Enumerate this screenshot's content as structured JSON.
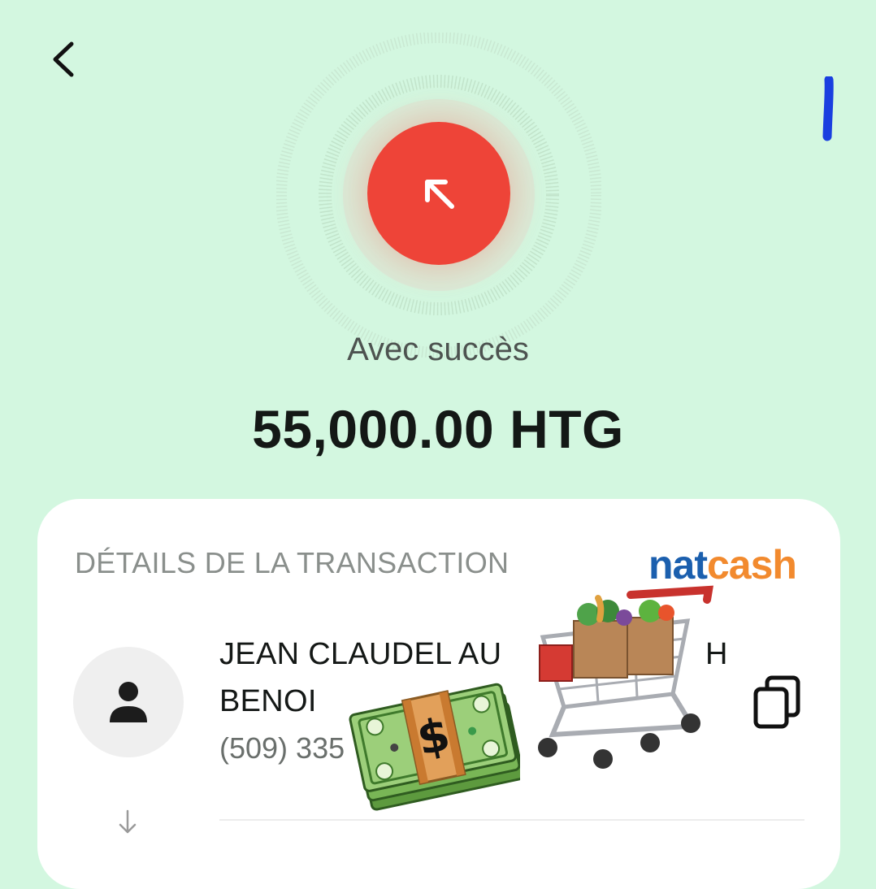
{
  "header": {
    "back_icon": "chevron-left-icon"
  },
  "status": {
    "label": "Avec succès",
    "icon": "arrow-up-left-icon",
    "color": "#ee4438"
  },
  "amount": "55,000.00 HTG",
  "details": {
    "section_title": "DÉTAILS DE LA TRANSACTION",
    "brand": {
      "part1": "nat",
      "part2": "cash",
      "color1": "#1b5fae",
      "color2": "#f28a2e"
    },
    "recipient": {
      "name_line1_a": "JEAN CLAUDEL AU",
      "name_line1_b": "H",
      "name_line2": "BENOI",
      "phone": "(509) 335",
      "avatar_icon": "person-icon"
    },
    "copy_icon": "copy-icon",
    "arrow_icon": "arrow-down-icon"
  },
  "stickers": [
    "money-stack-emoji",
    "shopping-cart-emoji"
  ]
}
